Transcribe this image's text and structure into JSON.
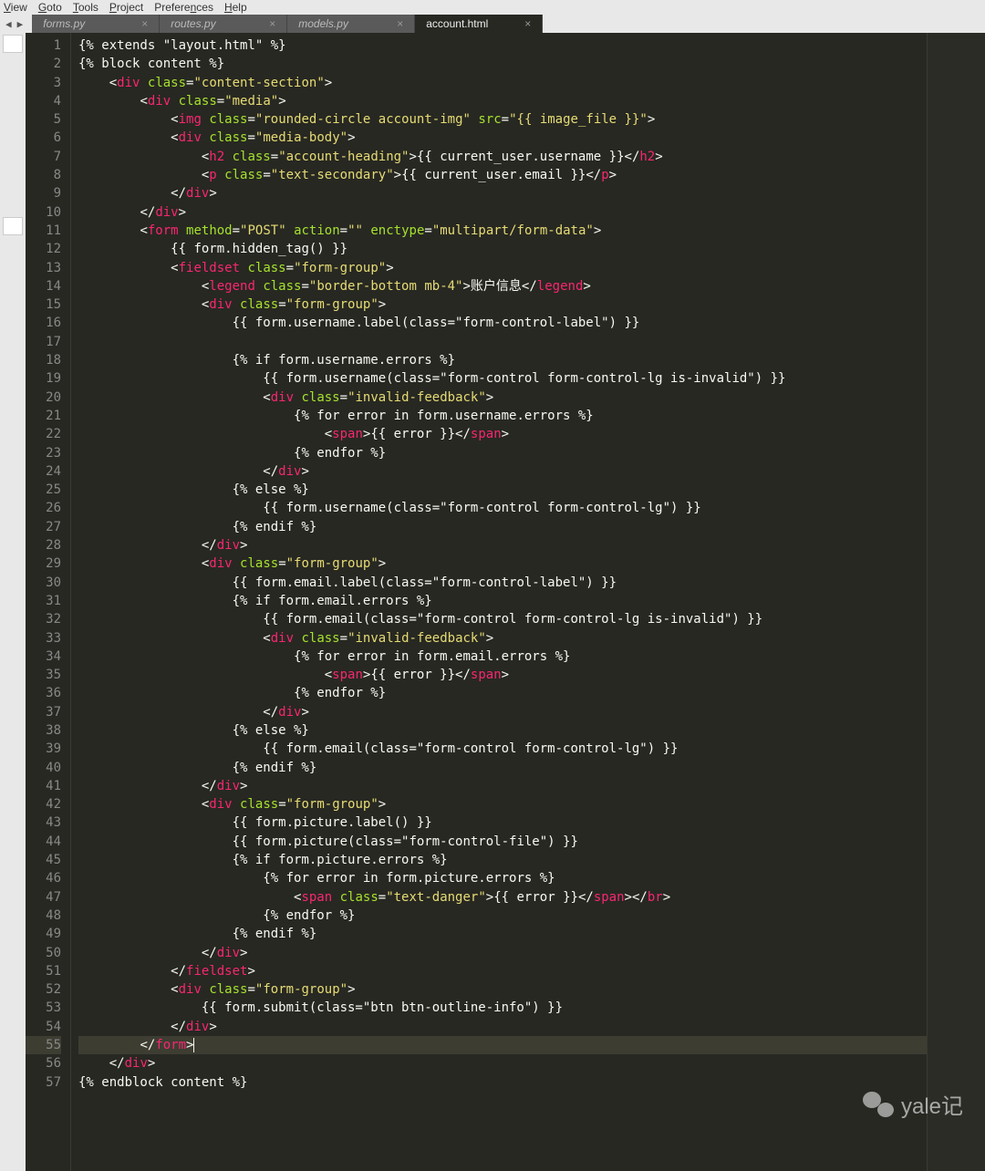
{
  "menu": {
    "items": [
      "View",
      "Goto",
      "Tools",
      "Project",
      "Preferences",
      "Help"
    ]
  },
  "tabs": [
    {
      "label": "forms.py",
      "active": false
    },
    {
      "label": "routes.py",
      "active": false
    },
    {
      "label": "models.py",
      "active": false
    },
    {
      "label": "account.html",
      "active": true
    }
  ],
  "watermark": "yale记",
  "active_line": 55,
  "code_lines": [
    "{% extends \"layout.html\" %}",
    "{% block content %}",
    "    <div class=\"content-section\">",
    "        <div class=\"media\">",
    "            <img class=\"rounded-circle account-img\" src=\"{{ image_file }}\">",
    "            <div class=\"media-body\">",
    "                <h2 class=\"account-heading\">{{ current_user.username }}</h2>",
    "                <p class=\"text-secondary\">{{ current_user.email }}</p>",
    "            </div>",
    "        </div>",
    "        <form method=\"POST\" action=\"\" enctype=\"multipart/form-data\">",
    "            {{ form.hidden_tag() }}",
    "            <fieldset class=\"form-group\">",
    "                <legend class=\"border-bottom mb-4\">账户信息</legend>",
    "                <div class=\"form-group\">",
    "                    {{ form.username.label(class=\"form-control-label\") }}",
    "",
    "                    {% if form.username.errors %}",
    "                        {{ form.username(class=\"form-control form-control-lg is-invalid\") }}",
    "                        <div class=\"invalid-feedback\">",
    "                            {% for error in form.username.errors %}",
    "                                <span>{{ error }}</span>",
    "                            {% endfor %}",
    "                        </div>",
    "                    {% else %}",
    "                        {{ form.username(class=\"form-control form-control-lg\") }}",
    "                    {% endif %}",
    "                </div>",
    "                <div class=\"form-group\">",
    "                    {{ form.email.label(class=\"form-control-label\") }}",
    "                    {% if form.email.errors %}",
    "                        {{ form.email(class=\"form-control form-control-lg is-invalid\") }}",
    "                        <div class=\"invalid-feedback\">",
    "                            {% for error in form.email.errors %}",
    "                                <span>{{ error }}</span>",
    "                            {% endfor %}",
    "                        </div>",
    "                    {% else %}",
    "                        {{ form.email(class=\"form-control form-control-lg\") }}",
    "                    {% endif %}",
    "                </div>",
    "                <div class=\"form-group\">",
    "                    {{ form.picture.label() }}",
    "                    {{ form.picture(class=\"form-control-file\") }}",
    "                    {% if form.picture.errors %}",
    "                        {% for error in form.picture.errors %}",
    "                            <span class=\"text-danger\">{{ error }}</span></br>",
    "                        {% endfor %}",
    "                    {% endif %}",
    "                </div>",
    "            </fieldset>",
    "            <div class=\"form-group\">",
    "                {{ form.submit(class=\"btn btn-outline-info\") }}",
    "            </div>",
    "        </form>",
    "    </div>",
    "{% endblock content %}"
  ]
}
